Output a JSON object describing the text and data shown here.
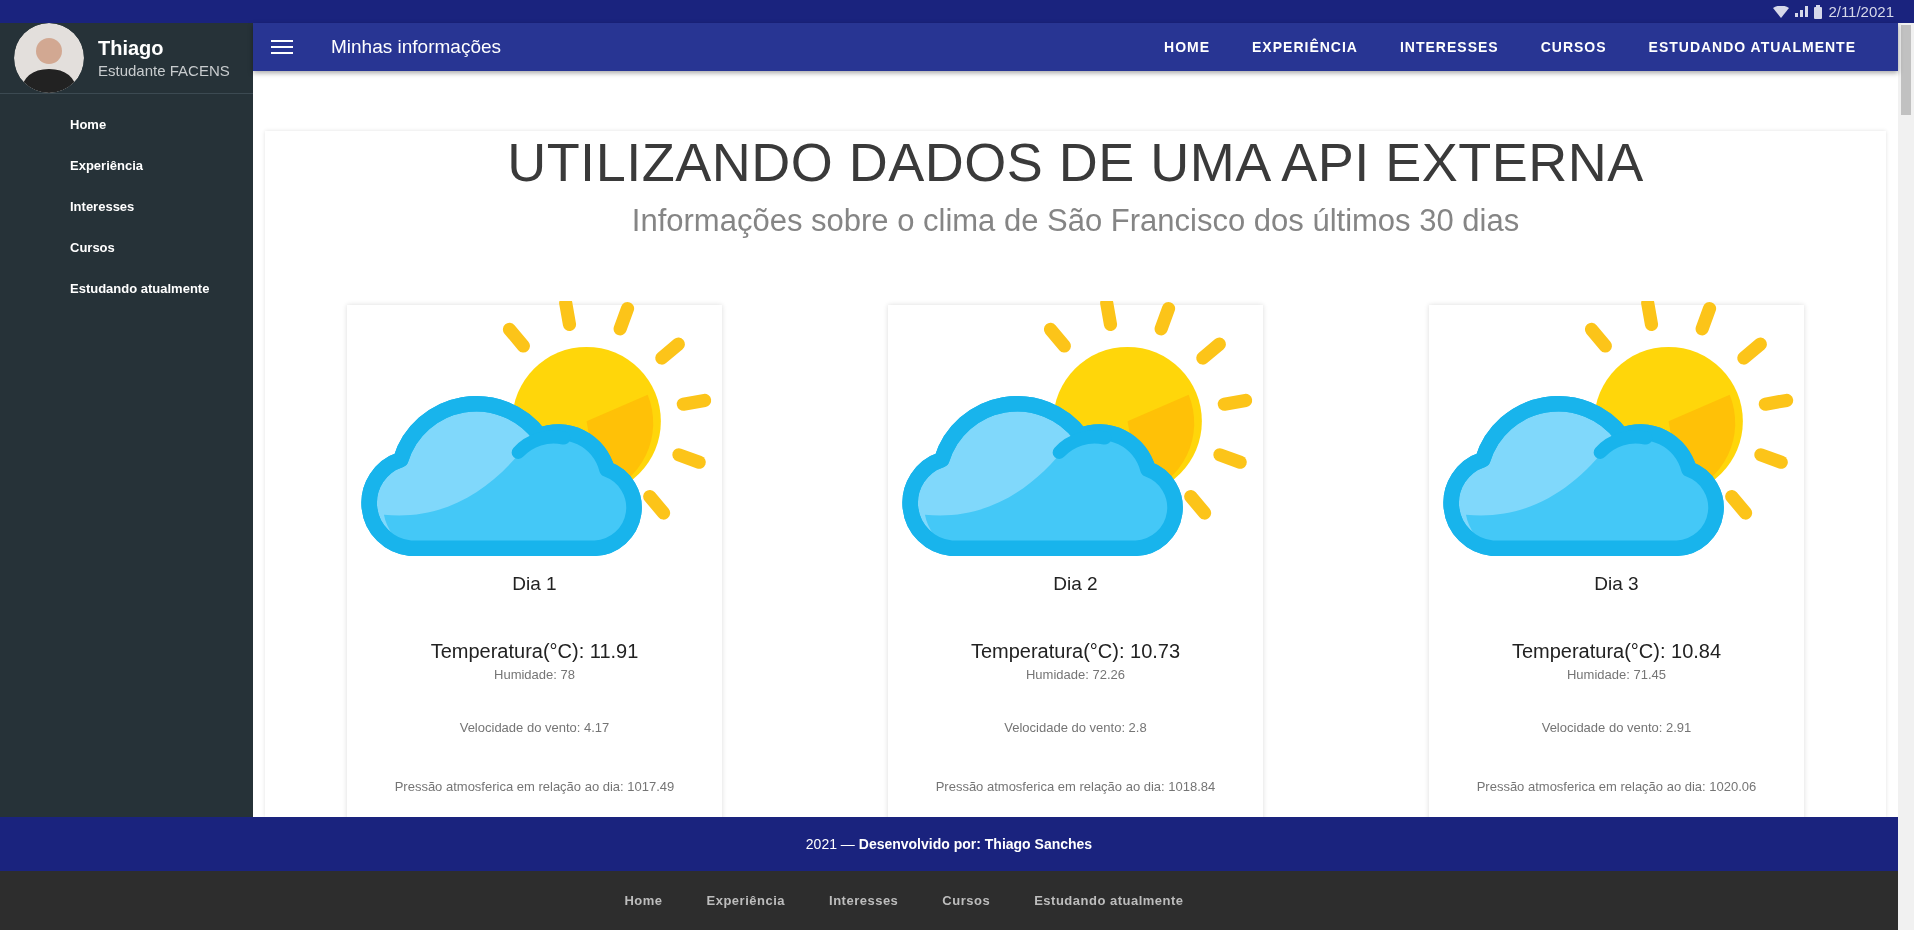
{
  "status_bar": {
    "date": "2/11/2021"
  },
  "profile": {
    "name": "Thiago",
    "subtitle": "Estudante FACENS"
  },
  "sidebar": {
    "items": [
      "Home",
      "Experiência",
      "Interesses",
      "Cursos",
      "Estudando atualmente"
    ]
  },
  "header": {
    "title": "Minhas informações",
    "nav": [
      "HOME",
      "EXPERIÊNCIA",
      "INTERESSES",
      "CURSOS",
      "ESTUDANDO ATUALMENTE"
    ]
  },
  "page": {
    "title": "UTILIZANDO DADOS DE UMA API EXTERNA",
    "subtitle": "Informações sobre o clima de São Francisco dos últimos 30 dias"
  },
  "days": [
    {
      "label": "Dia 1",
      "temperature": "Temperatura(°C): 11.91",
      "humidity": "Humidade: 78",
      "wind": "Velocidade do vento: 4.17",
      "pressure": "Pressão atmosferica em relação ao dia: 1017.49"
    },
    {
      "label": "Dia 2",
      "temperature": "Temperatura(°C): 10.73",
      "humidity": "Humidade: 72.26",
      "wind": "Velocidade do vento: 2.8",
      "pressure": "Pressão atmosferica em relação ao dia: 1018.84"
    },
    {
      "label": "Dia 3",
      "temperature": "Temperatura(°C): 10.84",
      "humidity": "Humidade: 71.45",
      "wind": "Velocidade do vento: 2.91",
      "pressure": "Pressão atmosferica em relação ao dia: 1020.06"
    }
  ],
  "footer": {
    "credit": "2021 — **Desenvolvido por: Thiago Sanches**",
    "links": [
      "Home",
      "Experiência",
      "Interesses",
      "Cursos",
      "Estudando atualmente"
    ]
  }
}
